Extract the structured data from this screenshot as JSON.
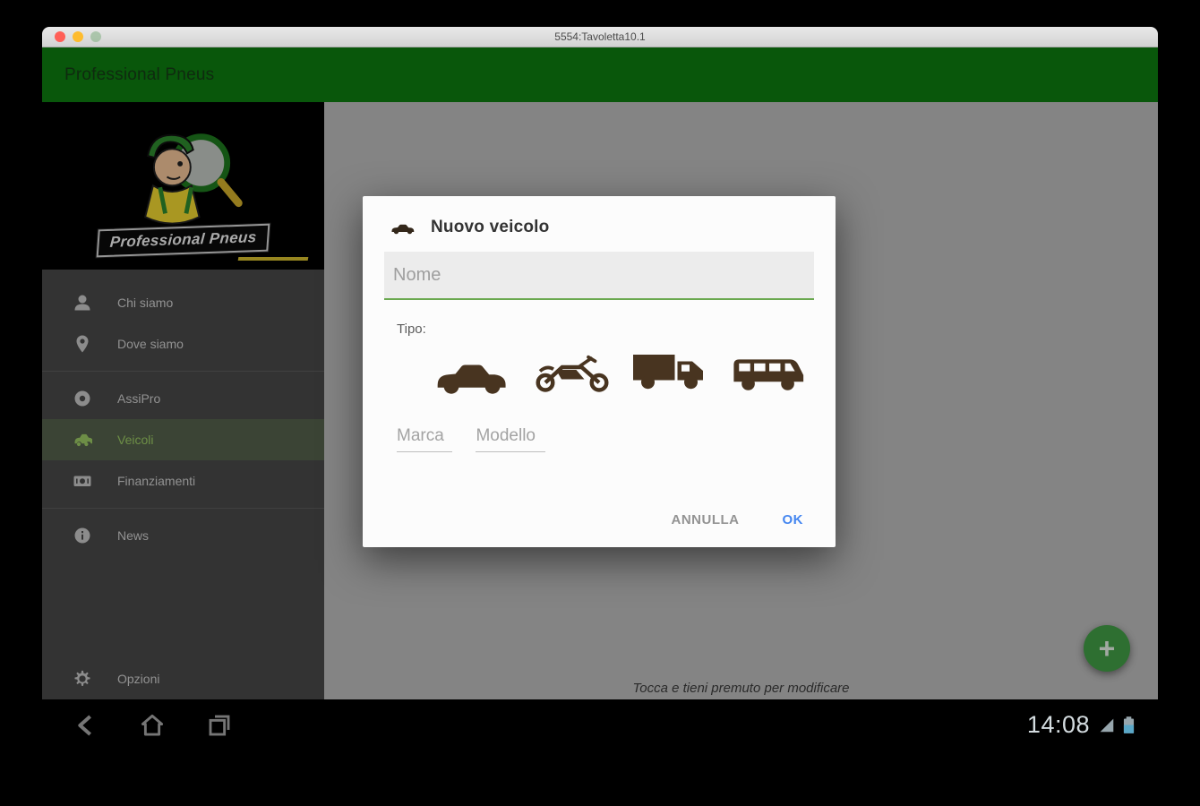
{
  "window": {
    "title": "5554:Tavoletta10.1"
  },
  "app_bar": {
    "title": "Professional Pneus"
  },
  "sidebar": {
    "logo_text": "Professional Pneus",
    "items": [
      {
        "label": "Chi siamo",
        "icon": "person-icon",
        "selected": false
      },
      {
        "label": "Dove siamo",
        "icon": "location-pin-icon",
        "selected": false
      },
      {
        "label": "AssiPro",
        "icon": "tire-icon",
        "selected": false
      },
      {
        "label": "Veicoli",
        "icon": "car-icon",
        "selected": true
      },
      {
        "label": "Finanziamenti",
        "icon": "banknote-icon",
        "selected": false
      },
      {
        "label": "News",
        "icon": "info-icon",
        "selected": false
      }
    ],
    "bottom_item": {
      "label": "Opzioni",
      "icon": "gear-icon"
    }
  },
  "main": {
    "hint": "Tocca e tieni premuto per modificare",
    "fab_label": "+"
  },
  "dialog": {
    "title": "Nuovo veicolo",
    "title_icon": "car-icon",
    "nome_placeholder": "Nome",
    "tipo_label": "Tipo:",
    "vehicle_types": [
      "car",
      "motorcycle",
      "truck",
      "van"
    ],
    "marca_placeholder": "Marca",
    "modello_placeholder": "Modello",
    "cancel_label": "ANNULLA",
    "ok_label": "OK"
  },
  "nav_bar": {
    "time": "14:08"
  },
  "colors": {
    "app_bar_green": "#0d7d11",
    "fab_green": "#43a047",
    "field_accent_green": "#6aa84f",
    "selected_item_green": "#9ccc65",
    "ok_blue": "#4486f0",
    "vehicle_icon_brown": "#483420"
  }
}
